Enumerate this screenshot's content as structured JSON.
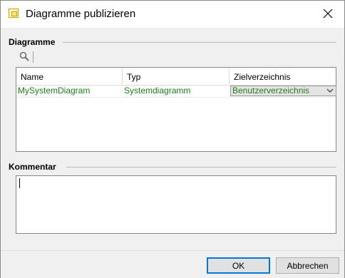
{
  "window": {
    "title": "Diagramme publizieren",
    "icons": {
      "app": "diagram-publish-icon",
      "close": "close-icon"
    }
  },
  "diagrams_section": {
    "header": "Diagramme",
    "toolbar_icon": "search-icon",
    "columns": [
      "Name",
      "Typ",
      "Zielverzeichnis"
    ],
    "rows": [
      {
        "name": "MySystemDiagram",
        "type": "Systemdiagramm",
        "target": "Benutzerverzeichnis"
      }
    ],
    "row_text_color": "#1e7d1e"
  },
  "comment_section": {
    "header": "Kommentar",
    "value": ""
  },
  "buttons": {
    "ok": "OK",
    "cancel": "Abbrechen"
  },
  "colors": {
    "accent": "#0078d7",
    "background": "#f0f0f0"
  }
}
